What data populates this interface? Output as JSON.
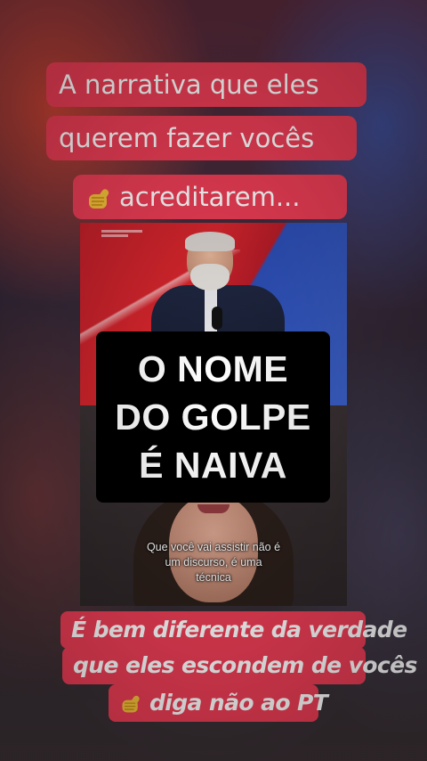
{
  "top_caption": {
    "lines": [
      "A narrativa que eles",
      "querem fazer vocês",
      "acreditarem..."
    ],
    "emoji": "pointing-hand-emoji",
    "background": "#ec3d55"
  },
  "headline": {
    "lines": [
      "O NOME",
      "DO GOLPE",
      "É NAIVA"
    ],
    "background": "#000000"
  },
  "subtitle": {
    "lines": [
      "Que você vai assistir não é",
      "um discurso, é uma",
      "técnica"
    ]
  },
  "bottom_caption": {
    "lines": [
      "É bem diferente da verdade",
      "que eles escondem de vocês",
      "diga não ao PT"
    ],
    "emoji": "pointing-hand-emoji",
    "background": "#ec3d55"
  }
}
